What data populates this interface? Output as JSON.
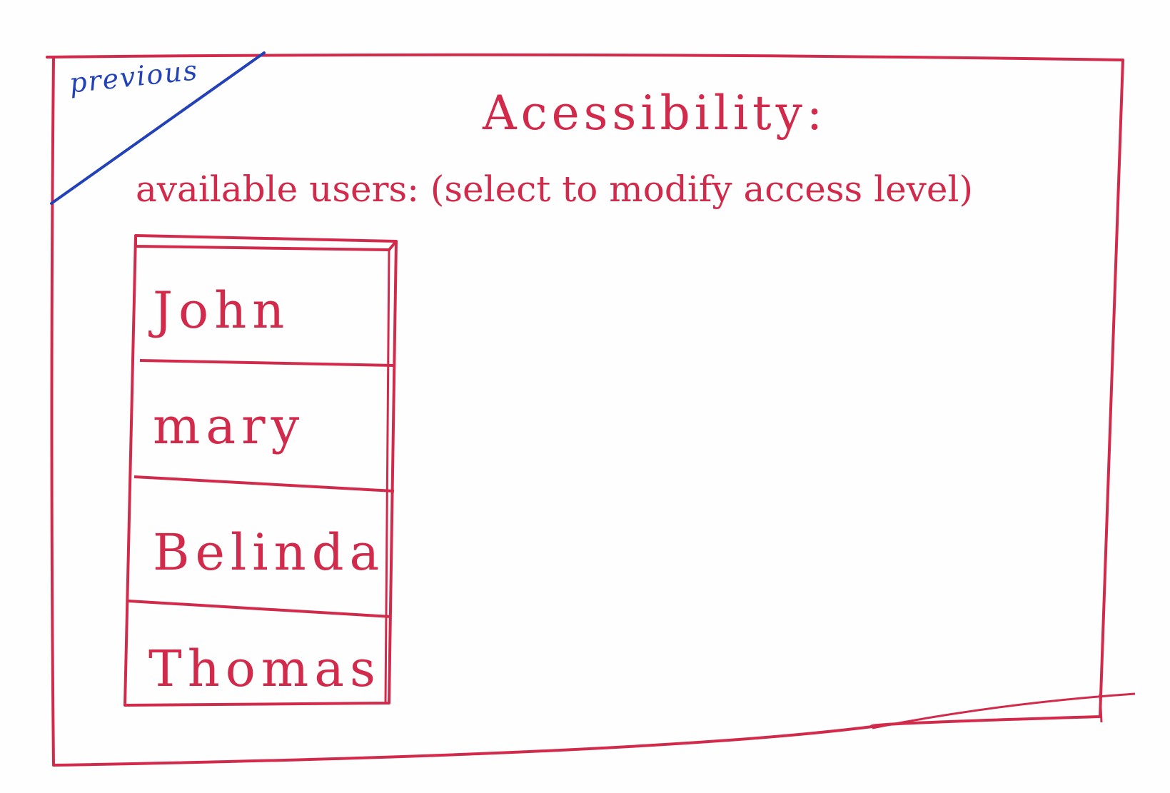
{
  "previous_button": {
    "label": "previous"
  },
  "page": {
    "title": "Acessibility:",
    "subtitle": "available users: (select to modify access level)"
  },
  "user_list": {
    "users": [
      {
        "name": "John"
      },
      {
        "name": "mary"
      },
      {
        "name": "Belinda"
      },
      {
        "name": "Thomas"
      }
    ]
  },
  "colors": {
    "sketch_red": "#d12a4a",
    "sketch_blue": "#2342b8",
    "paper": "#fefefe"
  }
}
